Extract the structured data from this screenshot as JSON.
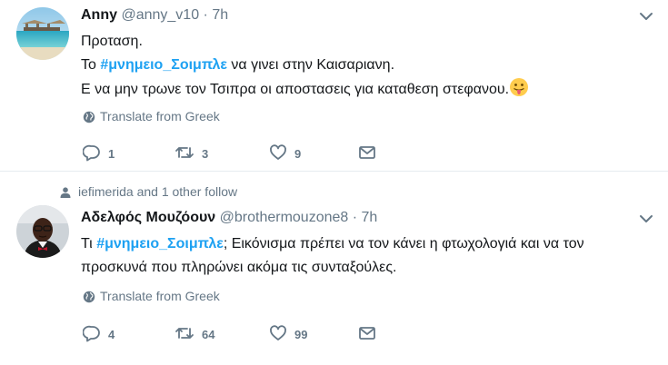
{
  "tweet1": {
    "name": "Anny",
    "handle": "@anny_v10",
    "dot": "·",
    "time": "7h",
    "line1": "Προταση.",
    "line2_prefix": "Το ",
    "hashtag": "#μνημειο_Σοιμπλε",
    "line2_suffix": " να γινει στην Καισαριανη.",
    "line3": "Ε να μην τρωνε τον Τσιπρα οι αποστασεις για καταθεση στεφανου.",
    "emoji": "tongue-out-emoji",
    "translate": "Translate from Greek",
    "replies": "1",
    "retweets": "3",
    "likes": "9"
  },
  "tweet2": {
    "social_context": "iefimerida and 1 other follow",
    "name": "Αδελφός Μουζόουν",
    "handle": "@brothermouzone8",
    "dot": "·",
    "time": "7h",
    "line1_prefix": "Τι ",
    "hashtag": "#μνημειο_Σοιμπλε",
    "line1_suffix": "; Εικόνισμα πρέπει να τον κάνει η φτωχολογιά και να τον",
    "line2": "προσκυνά που πληρώνει ακόμα τις συνταξούλες.",
    "translate": "Translate from Greek",
    "replies": "4",
    "retweets": "64",
    "likes": "99"
  },
  "colors": {
    "accent": "#1da1f2",
    "muted": "#657786",
    "text": "#14171a",
    "border": "#e6ecf0"
  },
  "icons": [
    "reply-icon",
    "retweet-icon",
    "like-icon",
    "dm-icon",
    "globe-icon",
    "caret-down-icon",
    "person-icon"
  ]
}
